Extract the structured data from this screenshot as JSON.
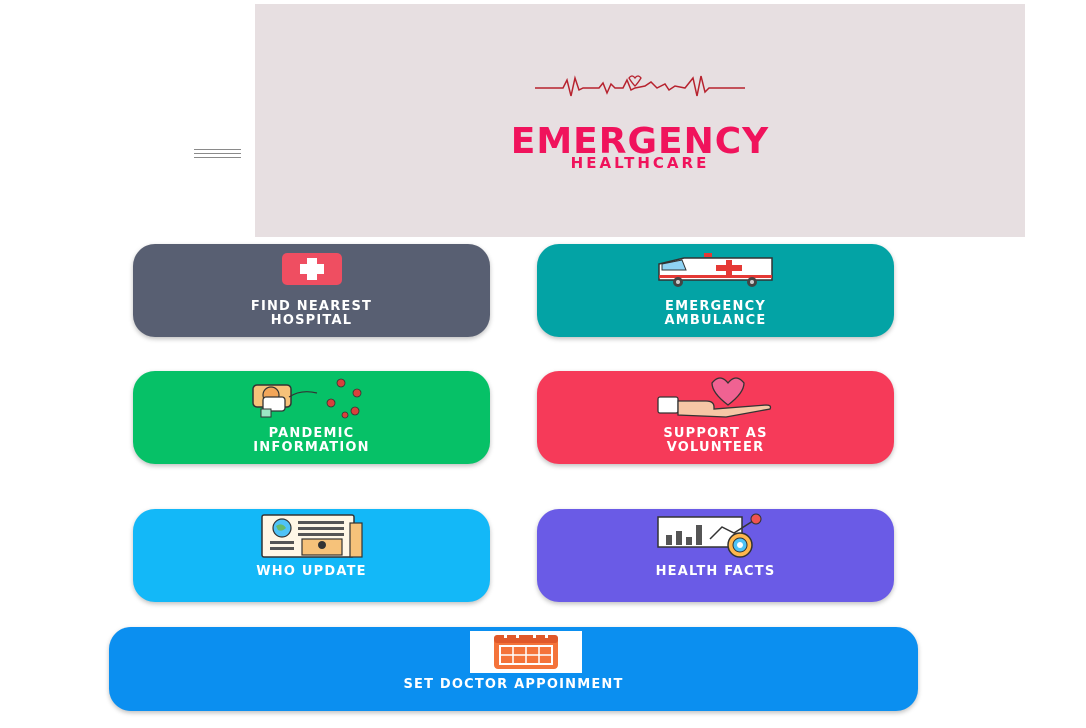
{
  "header": {
    "title": "EMERGENCY",
    "subtitle": "HEALTHCARE",
    "title_color": "#f0135c",
    "banner_bg": "#e7dfe1"
  },
  "menu": {
    "icon": "hamburger-menu-icon"
  },
  "tiles": [
    {
      "line1": "FIND NEAREST",
      "line2": "HOSPITAL",
      "color": "#585f72",
      "icon": "hospital-cross-icon"
    },
    {
      "line1": "EMERGENCY",
      "line2": "AMBULANCE",
      "color": "#03a3a5",
      "icon": "ambulance-icon"
    },
    {
      "line1": "PANDEMIC",
      "line2": "INFORMATION",
      "color": "#06c167",
      "icon": "virus-doctor-icon"
    },
    {
      "line1": "SUPPORT AS",
      "line2": "VOLUNTEER",
      "color": "#f63a59",
      "icon": "heart-hand-icon"
    },
    {
      "line1": "WHO UPDATE",
      "color": "#13b8f8",
      "icon": "newspaper-icon"
    },
    {
      "line1": "HEALTH FACTS",
      "color": "#6a5be6",
      "icon": "analytics-chart-icon"
    }
  ],
  "appointment": {
    "label": "SET DOCTOR APPOINMENT",
    "color": "#0b8ff0",
    "icon": "calendar-icon"
  }
}
